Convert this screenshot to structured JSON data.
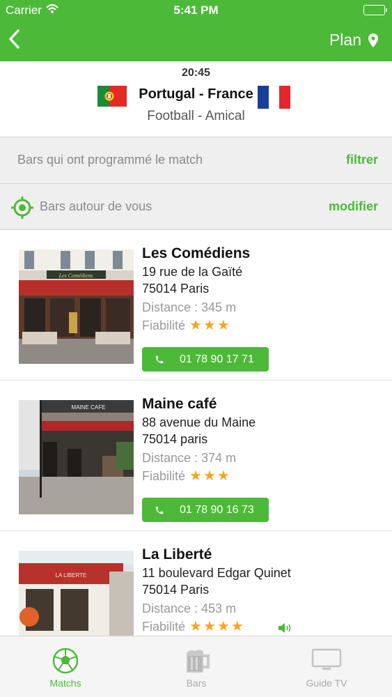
{
  "status_bar": {
    "carrier": "Carrier",
    "time": "5:41 PM"
  },
  "nav": {
    "back_label": "",
    "plan_label": "Plan"
  },
  "match": {
    "time": "20:45",
    "teams": "Portugal - France",
    "subtitle": "Football - Amical"
  },
  "filter_row": {
    "label": "Bars qui ont programmé le match",
    "action": "filtrer"
  },
  "location_row": {
    "label": "Bars autour de vous",
    "action": "modifier"
  },
  "bars": [
    {
      "name": "Les Comédiens",
      "address1": "19 rue de la Gaïté",
      "address2": "75014 Paris",
      "distance": "Distance : 345 m",
      "reliability_label": "Fiabilité",
      "stars": "★★★",
      "phone": "01 78 90 17 71"
    },
    {
      "name": "Maine café",
      "address1": "88 avenue du Maine",
      "address2": "75014 paris",
      "distance": "Distance : 374 m",
      "reliability_label": "Fiabilité",
      "stars": "★★★",
      "phone": "01 78 90 16 73"
    },
    {
      "name": "La Liberté",
      "address1": "11 boulevard Edgar Quinet",
      "address2": "75014 Paris",
      "distance": "Distance : 453 m",
      "reliability_label": "Fiabilité",
      "stars": "★★★★"
    }
  ],
  "tabs": [
    {
      "label": "Matchs",
      "icon": "football-icon"
    },
    {
      "label": "Bars",
      "icon": "beer-mug-icon"
    },
    {
      "label": "Guide TV",
      "icon": "tv-icon"
    }
  ],
  "colors": {
    "accent": "#4cba38",
    "star": "#f5a623"
  }
}
